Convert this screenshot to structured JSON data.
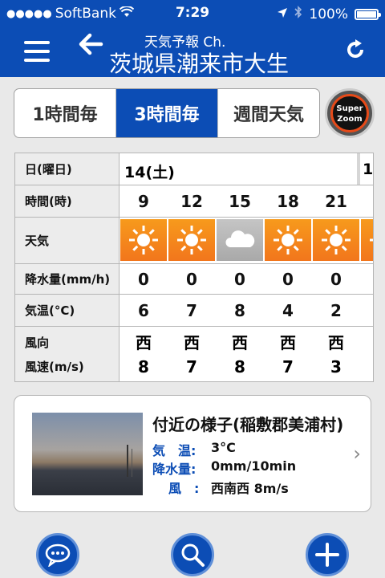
{
  "status": {
    "carrier": "SoftBank",
    "time": "7:29",
    "battery": "100%"
  },
  "nav": {
    "subtitle": "天気予報 Ch.",
    "title": "茨城県潮来市大生"
  },
  "tabs": [
    {
      "label": "1時間毎",
      "active": false
    },
    {
      "label": "3時間毎",
      "active": true
    },
    {
      "label": "週間天気",
      "active": false
    }
  ],
  "superzoom": {
    "line1": "Super",
    "line2": "Zoom"
  },
  "table": {
    "row_labels": {
      "date": "日(曜日)",
      "hour": "時間(時)",
      "weather": "天気",
      "precip": "降水量(mm/h)",
      "temp": "気温(°C)",
      "wind_dir": "風向",
      "wind_speed": "風速(m/s)"
    },
    "day": "14(土)",
    "next_day_partial": "1",
    "hours": [
      "9",
      "12",
      "15",
      "18",
      "21"
    ],
    "weather": [
      "sunny-icon",
      "sunny-icon",
      "cloudy-icon",
      "sunny-icon",
      "sunny-icon",
      "sunny-icon"
    ],
    "precip": [
      "0",
      "0",
      "0",
      "0",
      "0"
    ],
    "temp": [
      "6",
      "7",
      "8",
      "4",
      "2"
    ],
    "wind_dir": [
      "西",
      "西",
      "西",
      "西",
      "西",
      "南"
    ],
    "wind_speed": [
      "8",
      "7",
      "8",
      "7",
      "3"
    ]
  },
  "nearby": {
    "title": "付近の様子(稲敷郡美浦村)",
    "temp_label": "気　温:",
    "temp_value": "3°C",
    "precip_label": "降水量:",
    "precip_value": "0mm/10min",
    "wind_label": "風　:",
    "wind_value": "西南西 8m/s"
  },
  "colors": {
    "brand": "#0c4db5",
    "sunny": "#f58a1c",
    "cloudy": "#b5b5b5"
  }
}
